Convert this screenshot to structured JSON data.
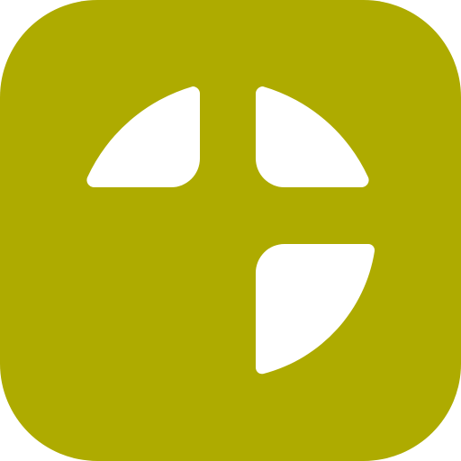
{
  "icon": {
    "name": "app-icon",
    "colors": {
      "background": "#AEAB00",
      "foreground": "#FFFFFF"
    }
  }
}
